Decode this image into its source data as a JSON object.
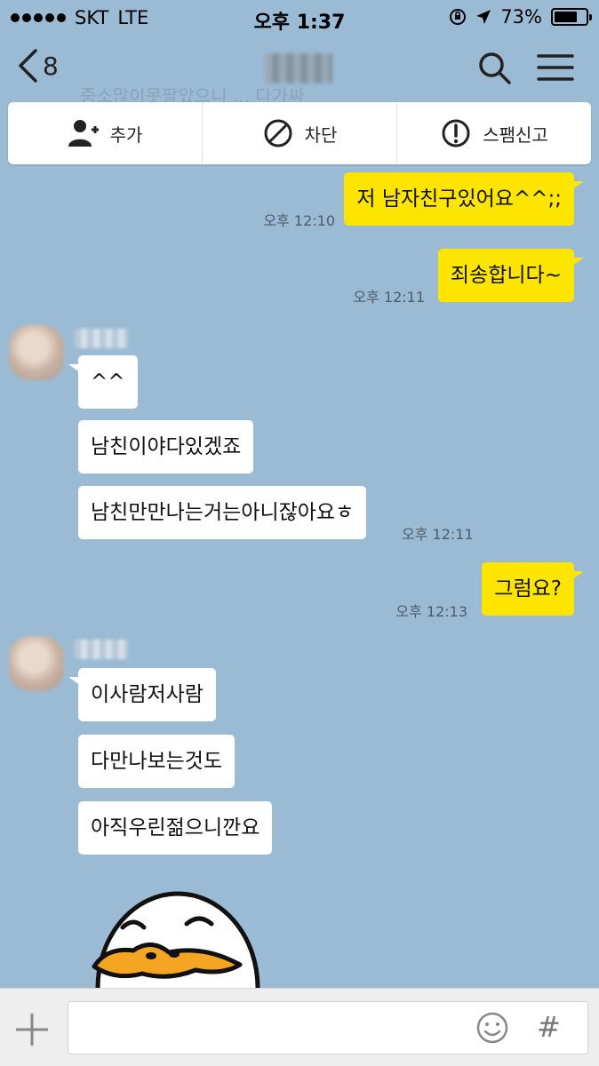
{
  "status_bar": {
    "carrier": "SKT",
    "network": "LTE",
    "time": "오후 1:37",
    "battery": "73%",
    "battery_level": 0.73
  },
  "nav": {
    "back_count": "8",
    "ghost_text": "중소많이못팔았으니 ... 다가싸"
  },
  "actions": [
    {
      "label": "추가",
      "icon": "add-friend-icon"
    },
    {
      "label": "차단",
      "icon": "block-icon"
    },
    {
      "label": "스팸신고",
      "icon": "report-icon"
    }
  ],
  "messages": [
    {
      "from": "me",
      "text": "저 남자친구있어요^^;;",
      "time": "오후 12:10"
    },
    {
      "from": "me",
      "text": "죄송합니다~",
      "time": "오후 12:11"
    },
    {
      "from": "them",
      "text": "^^"
    },
    {
      "from": "them",
      "text": "남친이야다있겠죠"
    },
    {
      "from": "them",
      "text": "남친만만나는거는아니잖아요ㅎ",
      "time": "오후 12:11"
    },
    {
      "from": "me",
      "text": "그럼요?",
      "time": "오후 12:13"
    },
    {
      "from": "them",
      "text": "이사람저사람"
    },
    {
      "from": "them",
      "text": "다만나보는것도"
    },
    {
      "from": "them",
      "text": "아직우린젊으니깐요"
    }
  ],
  "input": {
    "placeholder": "",
    "hash_label": "#"
  },
  "colors": {
    "background": "#9bbbd4",
    "my_bubble": "#fee500",
    "their_bubble": "#ffffff"
  }
}
